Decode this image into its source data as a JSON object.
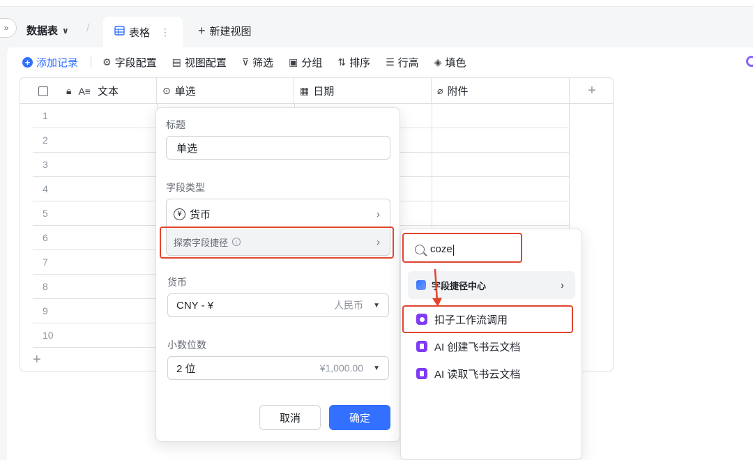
{
  "tabs_row": {
    "table_name": "数据表",
    "active_view": "表格",
    "new_view": "新建视图"
  },
  "toolbar": {
    "add_record": "添加记录",
    "field_config": "字段配置",
    "view_config": "视图配置",
    "filter": "筛选",
    "group": "分组",
    "sort": "排序",
    "row_height": "行高",
    "fill_color": "填色"
  },
  "grid": {
    "columns": [
      "文本",
      "单选",
      "日期",
      "附件"
    ],
    "rows": [
      "1",
      "2",
      "3",
      "4",
      "5",
      "6",
      "7",
      "8",
      "9",
      "10"
    ]
  },
  "field_panel": {
    "title_label": "标题",
    "title_value": "单选",
    "type_label": "字段类型",
    "type_value": "货币",
    "explore_shortcuts": "探索字段捷径",
    "currency_label": "货币",
    "currency_value": "CNY - ¥",
    "currency_hint": "人民币",
    "decimals_label": "小数位数",
    "decimals_value": "2 位",
    "decimals_hint": "¥1,000.00",
    "cancel": "取消",
    "confirm": "确定"
  },
  "shortcut_dropdown": {
    "search_value": "coze",
    "center": "字段捷径中心",
    "items": [
      "扣子工作流调用",
      "AI 创建飞书云文档",
      "AI 读取飞书云文档"
    ]
  },
  "colors": {
    "accent": "#3370ff",
    "annotation": "#e0452d",
    "app_icon": "#7f3bf5"
  }
}
